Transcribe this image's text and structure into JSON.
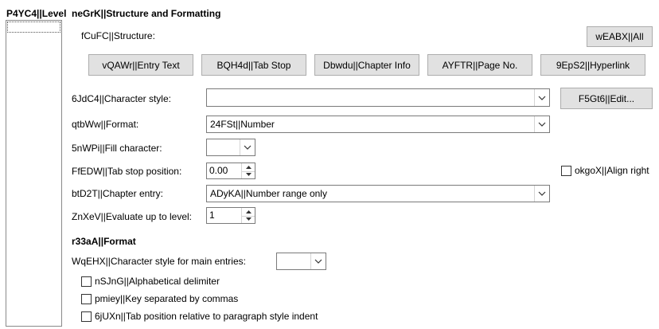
{
  "levels_panel": {
    "header": "P4YC4||Level",
    "items": [
      ""
    ]
  },
  "structure_section": {
    "title": "neGrK||Structure and Formatting",
    "structure_label": "fCuFC||Structure:",
    "all_button": "wEABX||All",
    "entry_buttons": [
      "vQAWr||Entry Text",
      "BQH4d||Tab Stop",
      "Dbwdu||Chapter Info",
      "AYFTR||Page No.",
      "9EpS2||Hyperlink"
    ],
    "character_style_label": "6JdC4||Character style:",
    "character_style_value": "",
    "edit_button": "F5Gt6||Edit...",
    "format_label": "qtbWw||Format:",
    "format_value": "24FSt||Number",
    "fill_character_label": "5nWPi||Fill character:",
    "fill_character_value": "",
    "tab_stop_position_label": "FfEDW||Tab stop position:",
    "tab_stop_position_value": "0.00",
    "align_right_label": "okgoX||Align right",
    "align_right_checked": false,
    "chapter_entry_label": "btD2T||Chapter entry:",
    "chapter_entry_value": "ADyKA||Number range only",
    "evaluate_level_label": "ZnXeV||Evaluate up to level:",
    "evaluate_level_value": "1"
  },
  "format_section": {
    "title": "r33aA||Format",
    "main_entries_style_label": "WqEHX||Character style for main entries:",
    "main_entries_style_value": "",
    "alphabetical_delimiter_label": "nSJnG||Alphabetical delimiter",
    "alphabetical_delimiter_checked": false,
    "key_separated_label": "pmiey||Key separated by commas",
    "key_separated_checked": false,
    "tab_relative_label": "6jUXn||Tab position relative to paragraph style indent",
    "tab_relative_checked": false
  }
}
